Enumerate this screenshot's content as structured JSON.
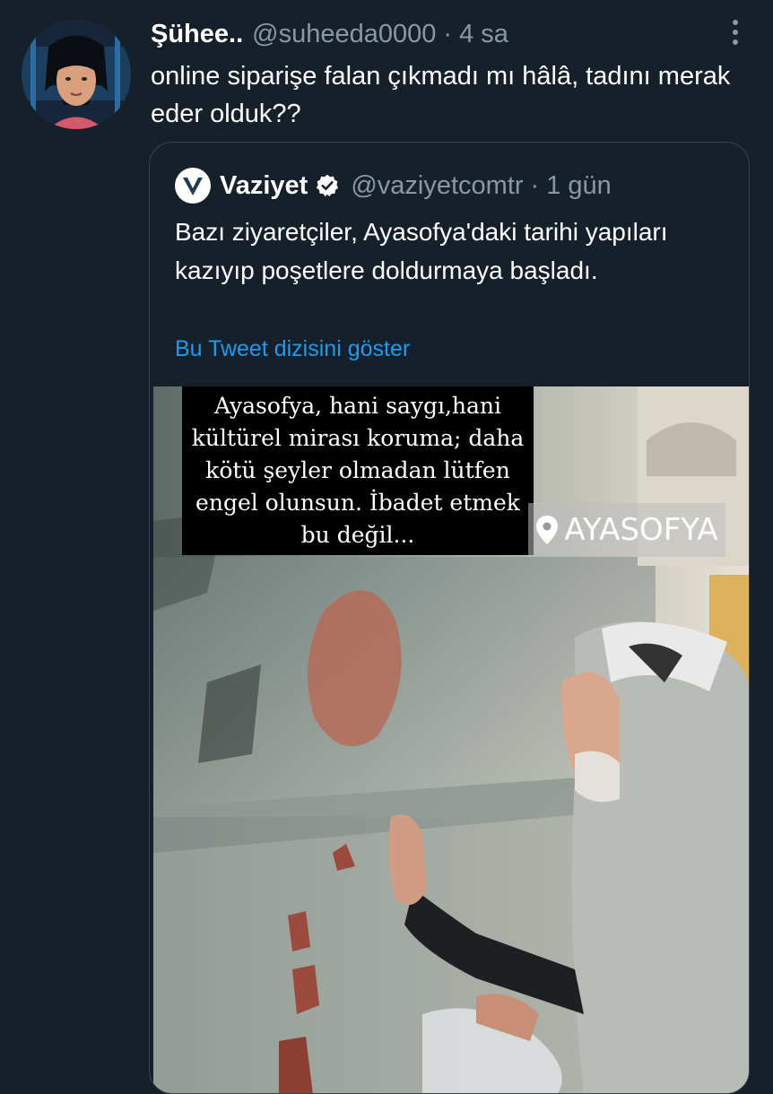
{
  "reply": {
    "author_name": "Şühee..",
    "handle": "@suheeda0000",
    "separator": "·",
    "time": "4 sa",
    "text": "online siparişe falan çıkmadı mı hâlâ, tadını merak eder olduk??",
    "avatar_icon": "avatar",
    "more_icon": "more-options-icon"
  },
  "quoted": {
    "author_name": "Vaziyet",
    "handle": "@vaziyetcomtr",
    "separator": "·",
    "time": "1 gün",
    "text": "Bazı ziyaretçiler, Ayasofya'daki tarihi yapıları kazıyıp poşetlere doldurmaya başladı.",
    "thread_link": "Bu Tweet dizisini göster",
    "verified_icon": "verified-badge-icon",
    "media": {
      "caption": "Ayasofya, hani saygı,hani kültürel mirası koruma; daha kötü şeyler olmadan lütfen engel olunsun. İbadet etmek bu değil...",
      "location_label": "AYASOFYA",
      "location_icon": "location-pin-icon"
    }
  },
  "colors": {
    "background": "#15202b",
    "secondary_text": "#8899a6",
    "link": "#1d9bf0",
    "border": "#38444d"
  }
}
